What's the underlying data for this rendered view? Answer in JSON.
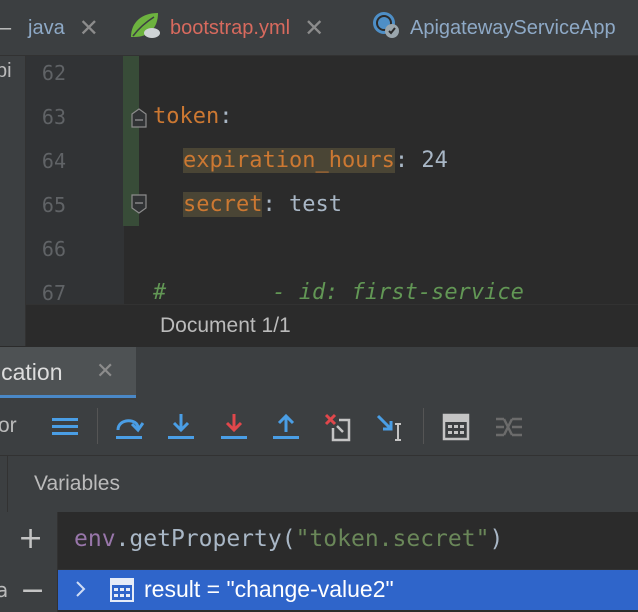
{
  "tabs": [
    {
      "label": "java",
      "icon": "java-file-icon"
    },
    {
      "label": "bootstrap.yml",
      "icon": "spring-leaf-icon"
    },
    {
      "label": "ApigatewayServiceApp",
      "icon": "spring-app-icon"
    }
  ],
  "project_strip": {
    "label": "pi"
  },
  "editor": {
    "line_numbers": [
      "62",
      "63",
      "64",
      "65",
      "66",
      "67"
    ],
    "lines": {
      "l63_key": "token",
      "l63_colon": ":",
      "l64_key": "expiration_hours",
      "l64_rest": ": 24",
      "l65_key": "secret",
      "l65_rest": ": test",
      "l67_comment": "#        - id: first-service"
    }
  },
  "breadcrumb": {
    "label": "Document 1/1"
  },
  "debug": {
    "tab_label": "ication",
    "toolbar_left_label": "or",
    "variables_label": "Variables",
    "expression": {
      "prefix": "env",
      "dot": ".",
      "method": "getProperty(",
      "arg": "\"token.secret\"",
      "close": ")"
    },
    "result": "result = \"change-value2\"",
    "left_letter": "a"
  },
  "colors": {
    "accent": "#4a88c7",
    "selection": "#2f65ca",
    "yaml_key": "#cc7832",
    "string": "#6a8759",
    "comment": "#629755"
  }
}
